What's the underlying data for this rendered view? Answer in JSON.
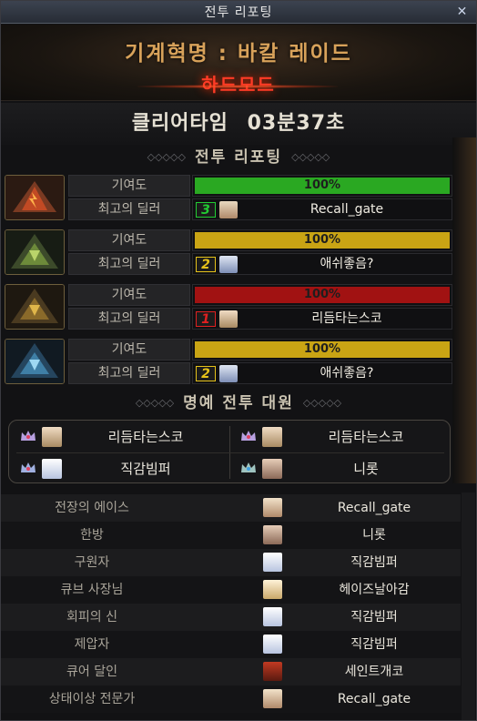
{
  "window": {
    "title": "전투 리포팅",
    "close_icon": "close-icon"
  },
  "banner": {
    "raid_name": "기계혁명 : 바칼 레이드",
    "mode": "하드모드"
  },
  "clear_time": {
    "label": "클리어타임",
    "value": "03분37초"
  },
  "report_section": {
    "title": "전투 리포팅"
  },
  "party": [
    {
      "contribution_label": "기여도",
      "contribution_text": "100%",
      "contribution_pct": 100,
      "bar_color": "#2aa822",
      "dealer_label": "최고의 딜러",
      "rank": "3",
      "rank_color": "#22cc33",
      "dealer_name": "Recall_gate",
      "portrait": "fire-emblem"
    },
    {
      "contribution_label": "기여도",
      "contribution_text": "100%",
      "contribution_pct": 100,
      "bar_color": "#c9a414",
      "dealer_label": "최고의 딜러",
      "rank": "2",
      "rank_color": "#e6c21a",
      "dealer_name": "애쉬좋음?",
      "portrait": "green-emblem"
    },
    {
      "contribution_label": "기여도",
      "contribution_text": "100%",
      "contribution_pct": 100,
      "bar_color": "#a11212",
      "dealer_label": "최고의 딜러",
      "rank": "1",
      "rank_color": "#e02020",
      "dealer_name": "리듬타는스코",
      "portrait": "gold-emblem"
    },
    {
      "contribution_label": "기여도",
      "contribution_text": "100%",
      "contribution_pct": 100,
      "bar_color": "#c9a414",
      "dealer_label": "최고의 딜러",
      "rank": "2",
      "rank_color": "#e6c21a",
      "dealer_name": "애쉬좋음?",
      "portrait": "ice-emblem"
    }
  ],
  "honor_section": {
    "title": "명예 전투 대원"
  },
  "honor": [
    {
      "name": "리듬타는스코"
    },
    {
      "name": "리듬타는스코"
    },
    {
      "name": "직감빔퍼"
    },
    {
      "name": "니롯"
    }
  ],
  "awards": [
    {
      "title": "전장의 에이스",
      "name": "Recall_gate"
    },
    {
      "title": "한방",
      "name": "니롯"
    },
    {
      "title": "구원자",
      "name": "직감빔퍼"
    },
    {
      "title": "큐브 사장님",
      "name": "헤이즈날아감"
    },
    {
      "title": "회피의 신",
      "name": "직감빔퍼"
    },
    {
      "title": "제압자",
      "name": "직감빔퍼"
    },
    {
      "title": "큐어 달인",
      "name": "세인트개코"
    },
    {
      "title": "상태이상 전문가",
      "name": "Recall_gate"
    }
  ]
}
